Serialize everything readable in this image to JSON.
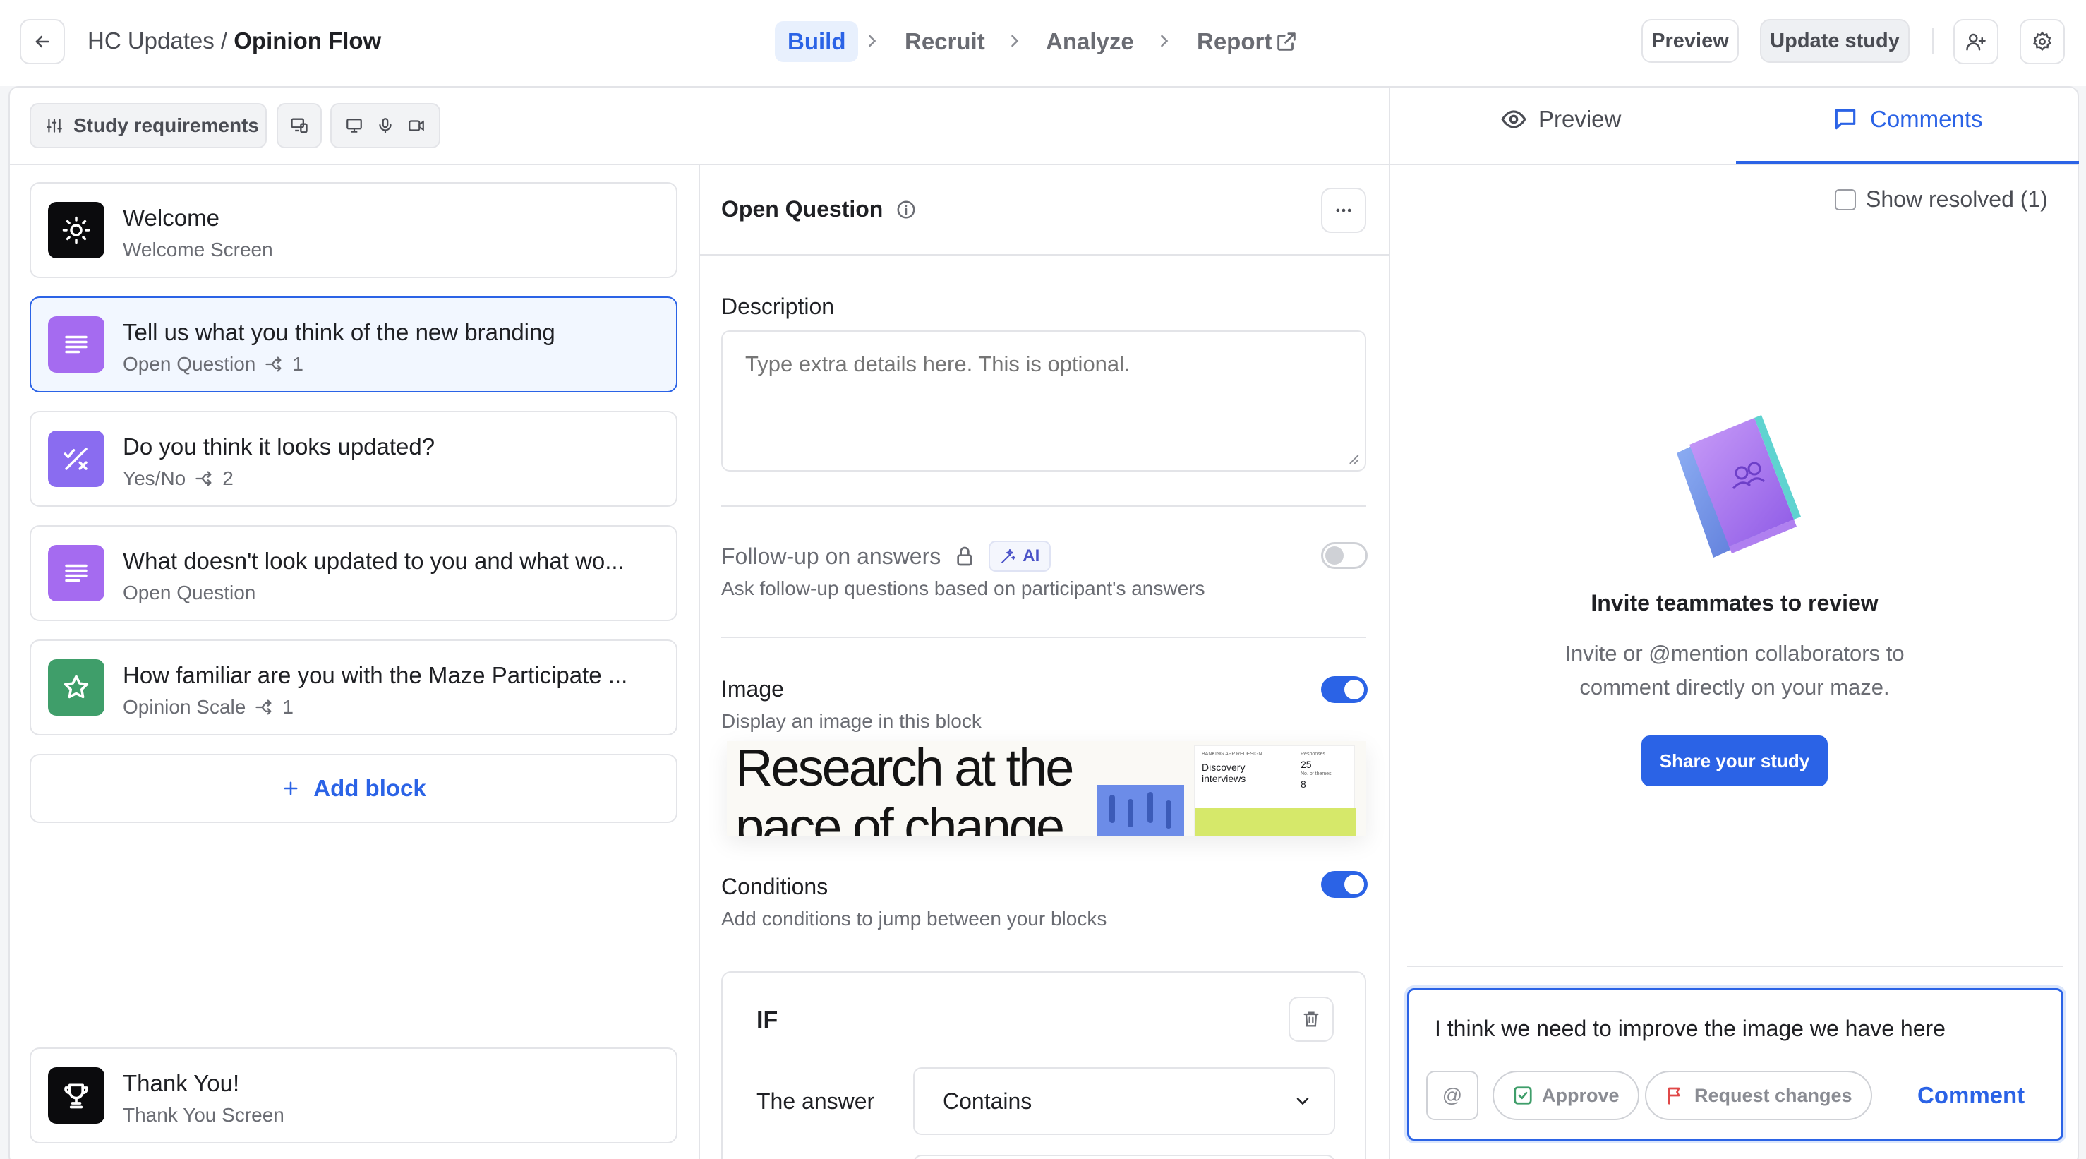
{
  "header": {
    "workspace": "HC Updates",
    "separator": "/",
    "study": "Opinion Flow",
    "steps": [
      "Build",
      "Recruit",
      "Analyze",
      "Report"
    ],
    "preview_label": "Preview",
    "update_label": "Update study"
  },
  "left": {
    "requirements_label": "Study requirements",
    "blocks": [
      {
        "title": "Welcome",
        "subtitle": "Welcome Screen",
        "count": ""
      },
      {
        "title": "Tell us what you think of the new branding",
        "subtitle": "Open Question",
        "count": "1"
      },
      {
        "title": "Do you think it looks updated?",
        "subtitle": "Yes/No",
        "count": "2"
      },
      {
        "title": "What doesn't look updated to you and what wo...",
        "subtitle": "Open Question",
        "count": ""
      },
      {
        "title": "How familiar are you with the Maze Participate ...",
        "subtitle": "Opinion Scale",
        "count": "1"
      }
    ],
    "add_block_label": "Add block",
    "thank_you": {
      "title": "Thank You!",
      "subtitle": "Thank You Screen"
    }
  },
  "middle": {
    "block_type": "Open Question",
    "description_label": "Description",
    "description_placeholder": "Type extra details here. This is optional.",
    "followup_label": "Follow-up on answers",
    "ai_badge": "AI",
    "followup_sub": "Ask follow-up questions based on participant's answers",
    "image_label": "Image",
    "image_sub": "Display an image in this block",
    "image_preview": {
      "headline_line1": "Research at the",
      "headline_line2": "pace of change",
      "card_kicker": "BANKING APP REDESIGN",
      "card_title": "Discovery interviews",
      "stat1_label": "Responses",
      "stat1_value": "25",
      "stat2_label": "No. of themes",
      "stat2_value": "8"
    },
    "conditions_label": "Conditions",
    "conditions_sub": "Add conditions to jump between your blocks",
    "if_label": "IF",
    "answer_label": "The answer",
    "operator_value": "Contains"
  },
  "right": {
    "tabs": [
      "Preview",
      "Comments"
    ],
    "show_resolved": "Show resolved (1)",
    "empty_title": "Invite teammates to review",
    "empty_body_line1": "Invite or @mention collaborators to",
    "empty_body_line2": "comment directly on your maze.",
    "share_label": "Share your study",
    "comment_text": "I think we need to improve the image we have here",
    "mention_label": "@",
    "approve_label": "Approve",
    "request_label": "Request changes",
    "comment_label": "Comment"
  },
  "colors": {
    "accent": "#2b63e6",
    "purple_block": "#a56bf0",
    "violet_block": "#8a6cf0",
    "green_block": "#3f9e6a"
  }
}
